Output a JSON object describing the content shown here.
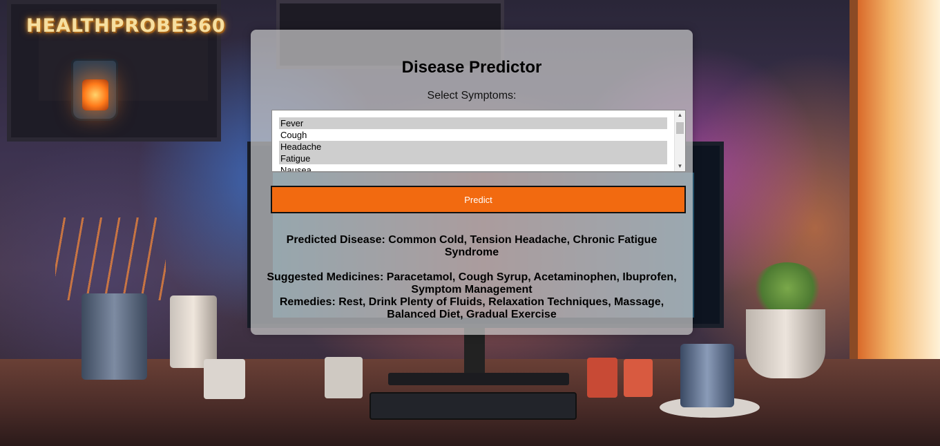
{
  "logo": {
    "text": "HEALTHPROBE360"
  },
  "panel": {
    "title": "Disease Predictor",
    "symptoms_label": "Select Symptoms:",
    "symptom_options": [
      {
        "label": "Fever",
        "selected": true
      },
      {
        "label": "Cough",
        "selected": false
      },
      {
        "label": "Headache",
        "selected": true
      },
      {
        "label": "Fatigue",
        "selected": true
      },
      {
        "label": "Nausea",
        "selected": false
      }
    ],
    "predict_label": "Predict",
    "predicted_disease": "Predicted Disease: Common Cold, Tension Headache, Chronic Fatigue Syndrome",
    "suggested_medicines": "Suggested Medicines: Paracetamol, Cough Syrup, Acetaminophen, Ibuprofen, Symptom Management",
    "remedies": "Remedies: Rest, Drink Plenty of Fluids, Relaxation Techniques, Massage, Balanced Diet, Gradual Exercise"
  },
  "colors": {
    "predict_button": "#f26a10",
    "selected_option": "#cecece"
  },
  "icons": {
    "scroll_up": "scroll-up-arrow-icon",
    "scroll_down": "scroll-down-arrow-icon"
  }
}
